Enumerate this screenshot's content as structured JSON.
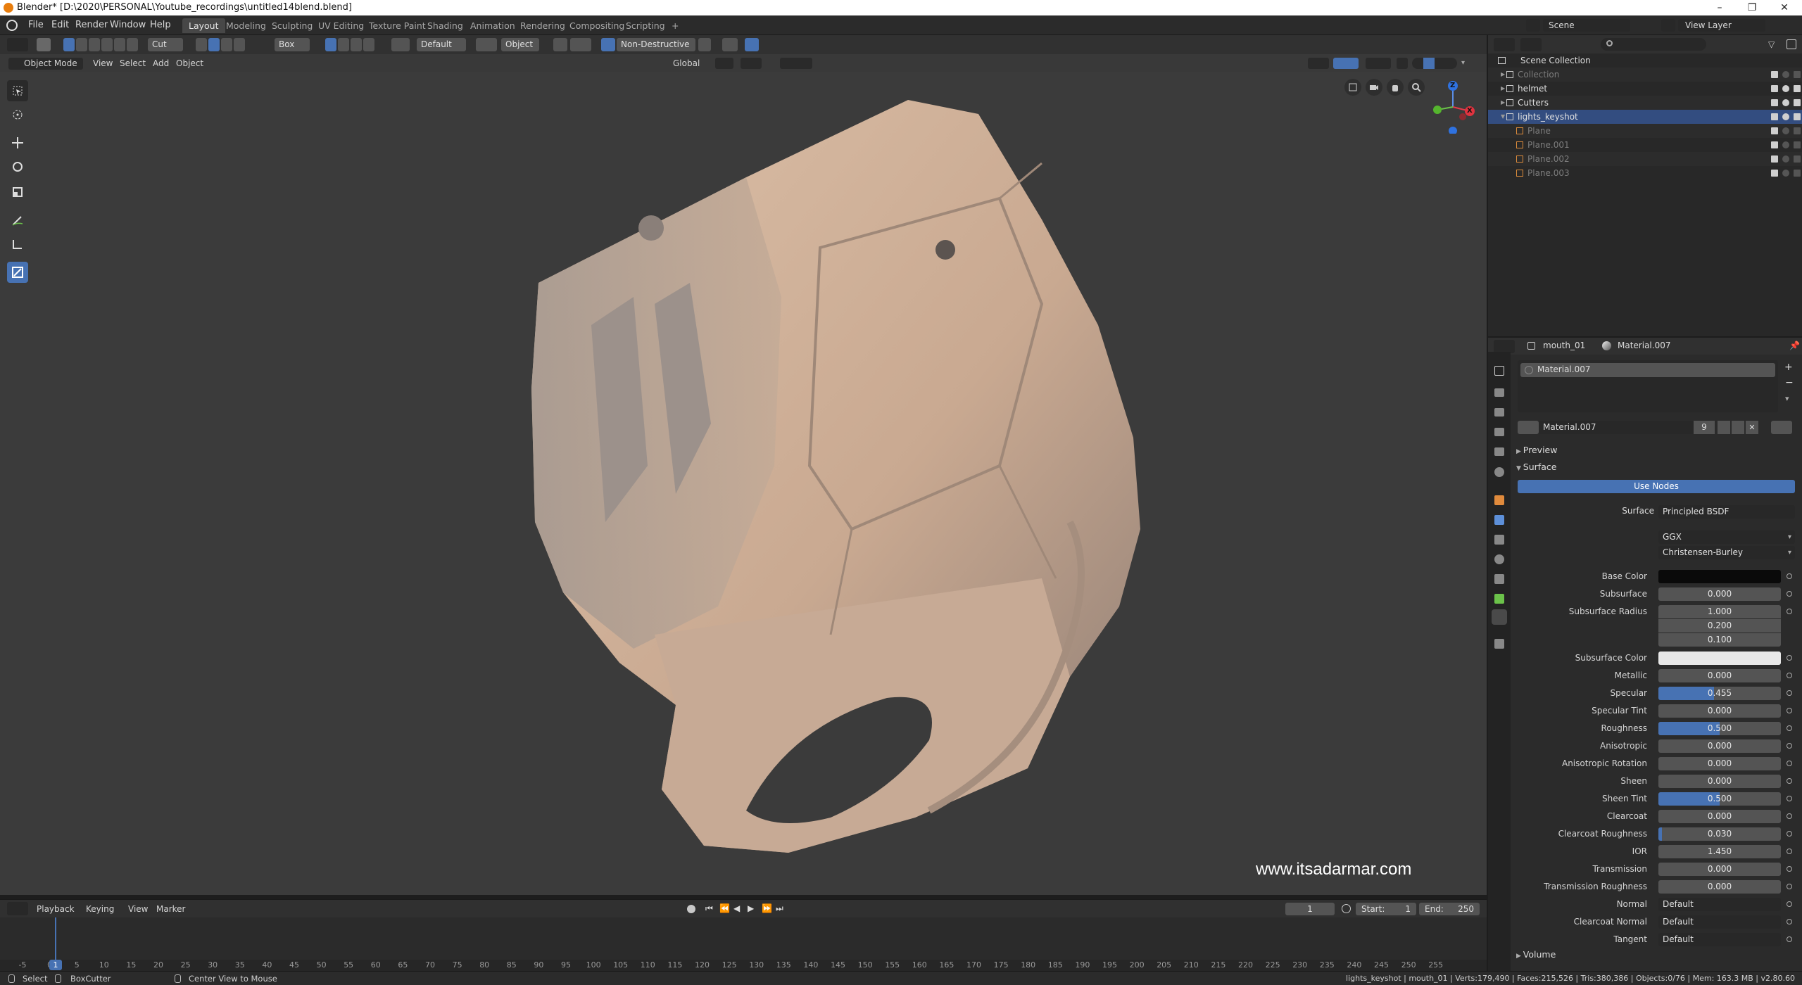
{
  "window": {
    "title": "Blender* [D:\\2020\\PERSONAL\\Youtube_recordings\\untitled14blend.blend]"
  },
  "menu": [
    "File",
    "Edit",
    "Render",
    "Window",
    "Help"
  ],
  "workspaces": [
    "Layout",
    "Modeling",
    "Sculpting",
    "UV Editing",
    "Texture Paint",
    "Shading",
    "Animation",
    "Rendering",
    "Compositing",
    "Scripting"
  ],
  "top_right": {
    "scene": "Scene",
    "view_layer": "View Layer"
  },
  "viewport_header": {
    "mode": "Object Mode",
    "menus": [
      "View",
      "Select",
      "Add",
      "Object"
    ],
    "cut": "Cut",
    "box": "Box",
    "default": "Default",
    "object": "Object",
    "non_destructive": "Non-Destructive",
    "orientation": "Global"
  },
  "viewport": {
    "watermark": "www.itsadarmar.com",
    "gizmo": {
      "x": "X",
      "y": "Y",
      "z": "Z"
    }
  },
  "timeline": {
    "menus": [
      "Playback",
      "Keying",
      "View",
      "Marker"
    ],
    "current_frame": "1",
    "start_label": "Start:",
    "start": "1",
    "end_label": "End:",
    "end": "250",
    "ticks": [
      "-5",
      "0",
      "5",
      "10",
      "15",
      "20",
      "25",
      "30",
      "35",
      "40",
      "45",
      "50",
      "55",
      "60",
      "65",
      "70",
      "75",
      "80",
      "85",
      "90",
      "95",
      "100",
      "105",
      "110",
      "115",
      "120",
      "125",
      "130",
      "135",
      "140",
      "145",
      "150",
      "155",
      "160",
      "165",
      "170",
      "175",
      "180",
      "185",
      "190",
      "195",
      "200",
      "205",
      "210",
      "215",
      "220",
      "225",
      "230",
      "235",
      "240",
      "245",
      "250",
      "255"
    ],
    "marker": "1"
  },
  "status": {
    "select": "Select",
    "boxcutter": "BoxCutter",
    "center_view": "Center View to Mouse",
    "stats": "lights_keyshot | mouth_01 | Verts:179,490 | Faces:215,526 | Tris:380,386 | Objects:0/76 | Mem: 163.3 MB | v2.80.60"
  },
  "outliner": {
    "root": "Scene Collection",
    "items": [
      {
        "name": "Collection",
        "depth": 1,
        "dim": true
      },
      {
        "name": "helmet",
        "depth": 1,
        "dim": false
      },
      {
        "name": "Cutters",
        "depth": 1,
        "dim": false
      },
      {
        "name": "lights_keyshot",
        "depth": 1,
        "dim": false,
        "selected": true
      },
      {
        "name": "Plane",
        "depth": 2,
        "dim": true
      },
      {
        "name": "Plane.001",
        "depth": 2,
        "dim": true
      },
      {
        "name": "Plane.002",
        "depth": 2,
        "dim": true
      },
      {
        "name": "Plane.003",
        "depth": 2,
        "dim": true
      }
    ]
  },
  "properties": {
    "object": "mouth_01",
    "material": "Material.007",
    "slot": "Material.007",
    "datablock": "Material.007",
    "users": "9",
    "sections": {
      "preview": "Preview",
      "surface": "Surface",
      "volume": "Volume"
    },
    "use_nodes": "Use Nodes",
    "surface_label": "Surface",
    "surface_value": "Principled BSDF",
    "distribution": "GGX",
    "subsurface_method": "Christensen-Burley",
    "fields": [
      {
        "label": "Base Color",
        "kind": "color",
        "color": "#0a0a0a"
      },
      {
        "label": "Subsurface",
        "kind": "num",
        "value": "0.000",
        "fill": 0
      },
      {
        "label": "Subsurface Radius",
        "kind": "vec",
        "values": [
          "1.000",
          "0.200",
          "0.100"
        ]
      },
      {
        "label": "Subsurface Color",
        "kind": "color",
        "color": "#e8e8e8"
      },
      {
        "label": "Metallic",
        "kind": "num",
        "value": "0.000",
        "fill": 0
      },
      {
        "label": "Specular",
        "kind": "num",
        "value": "0.455",
        "fill": 0.455
      },
      {
        "label": "Specular Tint",
        "kind": "num",
        "value": "0.000",
        "fill": 0
      },
      {
        "label": "Roughness",
        "kind": "num",
        "value": "0.500",
        "fill": 0.5
      },
      {
        "label": "Anisotropic",
        "kind": "num",
        "value": "0.000",
        "fill": 0
      },
      {
        "label": "Anisotropic Rotation",
        "kind": "num",
        "value": "0.000",
        "fill": 0
      },
      {
        "label": "Sheen",
        "kind": "num",
        "value": "0.000",
        "fill": 0
      },
      {
        "label": "Sheen Tint",
        "kind": "num",
        "value": "0.500",
        "fill": 0.5
      },
      {
        "label": "Clearcoat",
        "kind": "num",
        "value": "0.000",
        "fill": 0
      },
      {
        "label": "Clearcoat Roughness",
        "kind": "num",
        "value": "0.030",
        "fill": 0.03
      },
      {
        "label": "IOR",
        "kind": "num",
        "value": "1.450",
        "fill": 0
      },
      {
        "label": "Transmission",
        "kind": "num",
        "value": "0.000",
        "fill": 0
      },
      {
        "label": "Transmission Roughness",
        "kind": "num",
        "value": "0.000",
        "fill": 0
      },
      {
        "label": "Normal",
        "kind": "select",
        "value": "Default"
      },
      {
        "label": "Clearcoat Normal",
        "kind": "select",
        "value": "Default"
      },
      {
        "label": "Tangent",
        "kind": "select",
        "value": "Default"
      }
    ]
  },
  "colors": {
    "accent": "#4772b3",
    "selection": "#334d80",
    "model": "#d4b49c"
  }
}
